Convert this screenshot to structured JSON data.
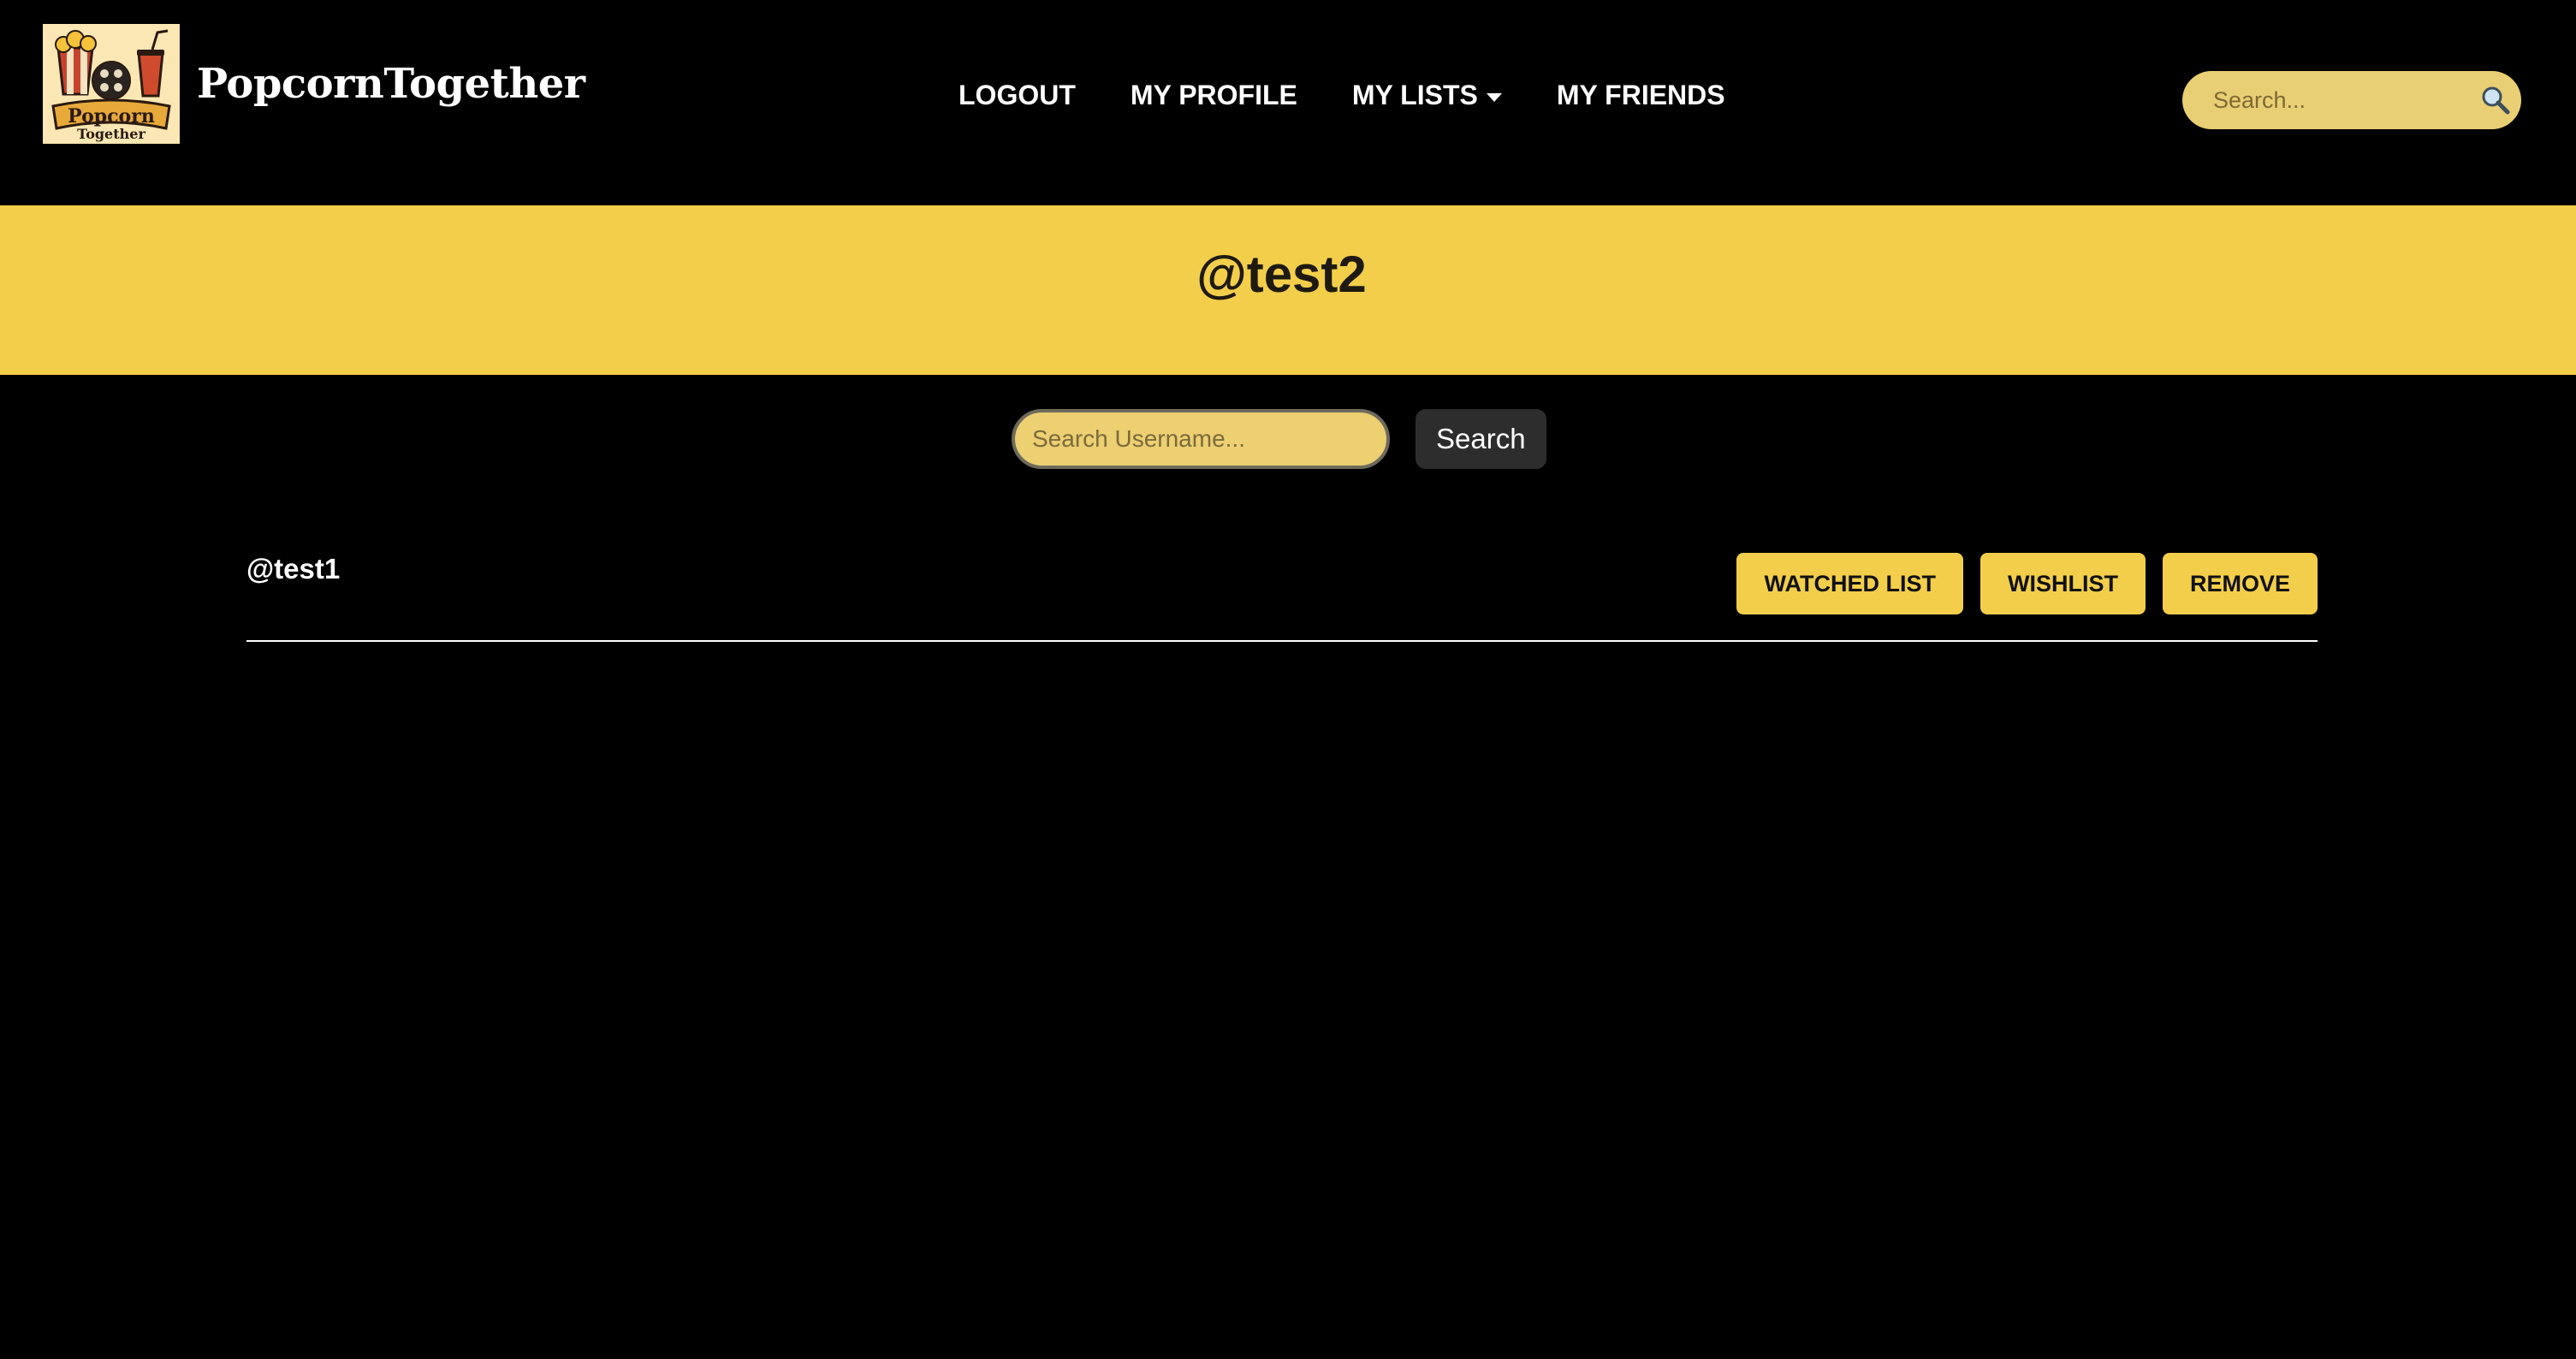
{
  "brand": {
    "name": "PopcornTogether",
    "logo_text_top": "Popcorn",
    "logo_text_bottom": "Together"
  },
  "nav": {
    "items": [
      {
        "label": "LOGOUT"
      },
      {
        "label": "MY PROFILE"
      },
      {
        "label": "MY LISTS",
        "has_dropdown": true
      },
      {
        "label": "MY FRIENDS"
      }
    ]
  },
  "top_search": {
    "placeholder": "Search...",
    "icon": "search-icon"
  },
  "banner": {
    "username": "@test2"
  },
  "friend_search": {
    "placeholder": "Search Username...",
    "button_label": "Search"
  },
  "friends": [
    {
      "username": "@test1",
      "actions": [
        "WATCHED LIST",
        "WISHLIST",
        "REMOVE"
      ]
    }
  ],
  "colors": {
    "accent": "#f2ce4b",
    "background": "#000000",
    "input_fill": "#e9cf74"
  }
}
